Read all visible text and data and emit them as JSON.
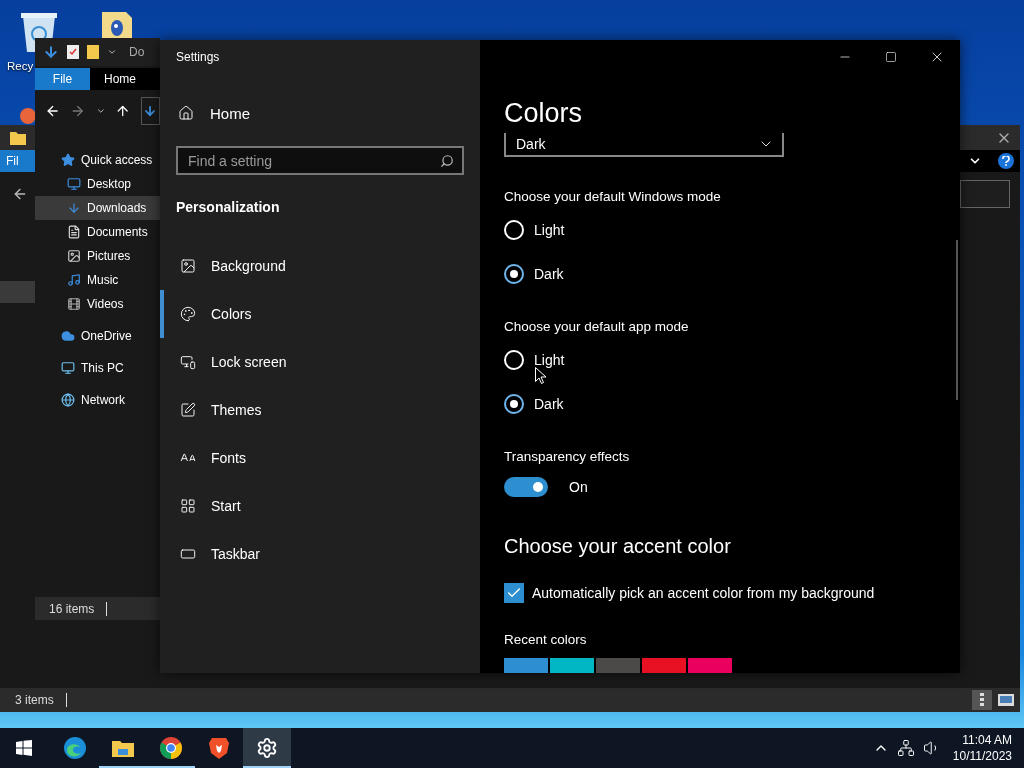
{
  "desktop": {
    "icons": [
      {
        "label": "Recy"
      }
    ]
  },
  "explorer_back": {
    "file_tab": "Fil",
    "status": "3 items"
  },
  "explorer_front": {
    "title": "Do",
    "ribbon_tabs": [
      {
        "label": "File",
        "selected": true
      },
      {
        "label": "Home",
        "selected": false
      }
    ],
    "nav": [
      {
        "label": "Quick access",
        "kind": "star",
        "selected": false,
        "children": [
          {
            "label": "Desktop",
            "kind": "desktop",
            "selected": false
          },
          {
            "label": "Downloads",
            "kind": "download",
            "selected": true
          },
          {
            "label": "Documents",
            "kind": "document",
            "selected": false
          },
          {
            "label": "Pictures",
            "kind": "pictures",
            "selected": false
          },
          {
            "label": "Music",
            "kind": "music",
            "selected": false
          },
          {
            "label": "Videos",
            "kind": "videos",
            "selected": false
          }
        ]
      },
      {
        "label": "OneDrive",
        "kind": "cloud",
        "selected": false
      },
      {
        "label": "This PC",
        "kind": "pc",
        "selected": false
      },
      {
        "label": "Network",
        "kind": "network",
        "selected": false
      }
    ],
    "status": "16 items"
  },
  "settings": {
    "title": "Settings",
    "home": "Home",
    "search": {
      "placeholder": "Find a setting"
    },
    "section": "Personalization",
    "nav": [
      {
        "label": "Background",
        "kind": "background",
        "selected": false
      },
      {
        "label": "Colors",
        "kind": "colors",
        "selected": true
      },
      {
        "label": "Lock screen",
        "kind": "lock",
        "selected": false
      },
      {
        "label": "Themes",
        "kind": "themes",
        "selected": false
      },
      {
        "label": "Fonts",
        "kind": "fonts",
        "selected": false
      },
      {
        "label": "Start",
        "kind": "start",
        "selected": false
      },
      {
        "label": "Taskbar",
        "kind": "taskbar",
        "selected": false
      }
    ],
    "page_title": "Colors",
    "dropdown": {
      "value": "Dark"
    },
    "groups": [
      {
        "label": "Choose your default Windows mode",
        "options": [
          {
            "label": "Light",
            "selected": false
          },
          {
            "label": "Dark",
            "selected": true
          }
        ]
      },
      {
        "label": "Choose your default app mode",
        "options": [
          {
            "label": "Light",
            "selected": false
          },
          {
            "label": "Dark",
            "selected": true
          }
        ]
      }
    ],
    "transparency": {
      "label": "Transparency effects",
      "on": true,
      "state_label": "On"
    },
    "accent_heading": "Choose your accent color",
    "auto_pick": {
      "label": "Automatically pick an accent color from my background",
      "checked": true
    },
    "recent_colors": {
      "label": "Recent colors",
      "swatches": [
        {
          "color": "#2d8fd0"
        },
        {
          "color": "#00b7c3"
        },
        {
          "color": "#4c4a48"
        },
        {
          "color": "#e81123"
        },
        {
          "color": "#ea005e"
        }
      ]
    }
  },
  "taskbar": {
    "apps": [
      {
        "kind": "start",
        "running": false,
        "selected": false
      },
      {
        "kind": "edge",
        "running": false,
        "selected": false
      },
      {
        "kind": "explorer",
        "running": true,
        "selected": false
      },
      {
        "kind": "chrome",
        "running": true,
        "selected": false
      },
      {
        "kind": "brave",
        "running": false,
        "selected": false
      },
      {
        "kind": "settings",
        "running": true,
        "selected": true
      }
    ],
    "time": "11:04 AM",
    "date": "10/11/2023"
  }
}
